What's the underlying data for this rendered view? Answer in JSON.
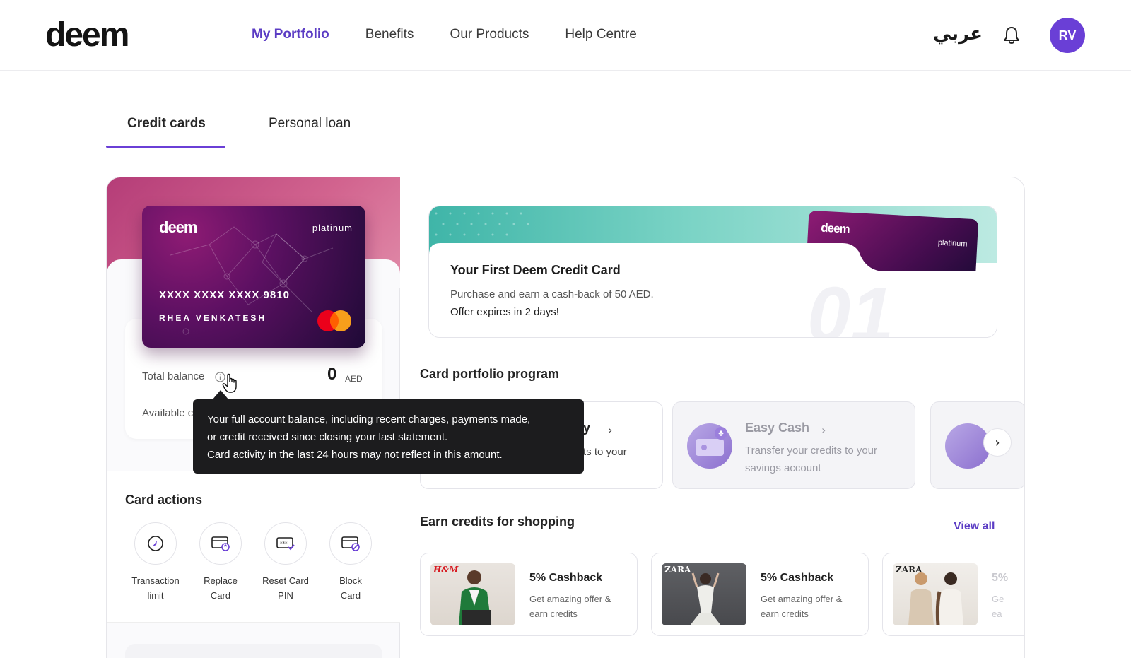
{
  "brand": {
    "logo": "deem",
    "accent": "#5b3cc4",
    "hero_pink": "#c04d82"
  },
  "nav": {
    "links": [
      "My Portfolio",
      "Benefits",
      "Our Products",
      "Help Centre"
    ],
    "active": "My Portfolio",
    "language_toggle": "عربي",
    "avatar_initials": "RV",
    "icons": {
      "notifications": "bell-icon"
    }
  },
  "tabs": {
    "items": [
      "Credit cards",
      "Personal loan"
    ],
    "active": "Credit cards"
  },
  "card": {
    "logo": "deem",
    "tier": "platinum",
    "number": "XXXX XXXX XXXX 9810",
    "holder": "RHEA VENKATESH",
    "network_icon": "mastercard-icon"
  },
  "balance": {
    "total_label": "Total balance",
    "total_value": "0",
    "currency": "AED",
    "available_label": "Available c"
  },
  "tooltip": {
    "line1": "Your full account balance, including recent charges, payments made,",
    "line2": "or credit received since closing your last statement.",
    "line3": "Card activity in the last 24 hours may not reflect in this amount."
  },
  "card_actions": {
    "title": "Card actions",
    "items": [
      {
        "label_line1": "Transaction",
        "label_line2": "limit",
        "icon": "gauge-icon"
      },
      {
        "label_line1": "Replace",
        "label_line2": "Card",
        "icon": "card-replace-icon"
      },
      {
        "label_line1": "Reset Card",
        "label_line2": "PIN",
        "icon": "card-pin-icon"
      },
      {
        "label_line1": "Block",
        "label_line2": "Card",
        "icon": "card-block-icon"
      }
    ]
  },
  "promo": {
    "card_logo": "deem",
    "card_tier": "platinum",
    "title": "Your First Deem Credit Card",
    "description": "Purchase and earn a cash-back of 50 AED.",
    "expiry": "Offer expires in 2 days!",
    "watermark": "01"
  },
  "portfolio_program": {
    "title": "Card portfolio program",
    "items": [
      {
        "title": "iary",
        "desc": "edits to your"
      },
      {
        "title": "Easy Cash",
        "desc_line1": "Transfer your credits to your",
        "desc_line2": "savings account"
      }
    ]
  },
  "shopping": {
    "title": "Earn credits for shopping",
    "view_all": "View all",
    "offers": [
      {
        "brand": "H&M",
        "title": "5% Cashback",
        "desc_line1": "Get amazing offer &",
        "desc_line2": "earn credits"
      },
      {
        "brand": "ZARA",
        "title": "5% Cashback",
        "desc_line1": "Get amazing offer &",
        "desc_line2": "earn credits"
      },
      {
        "brand": "ZARA",
        "title": "5%",
        "desc_line1": "Ge",
        "desc_line2": "ea"
      }
    ]
  }
}
